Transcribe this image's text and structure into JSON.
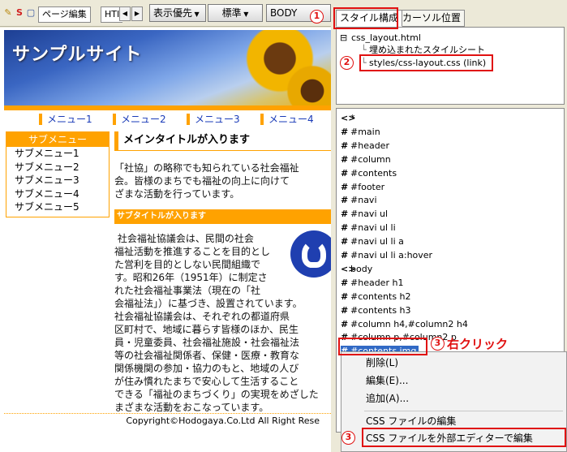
{
  "toolbar": {
    "tab_page_edit": "ページ編集",
    "tab_html": "HTI",
    "display_priority": "表示優先",
    "standard": "標準",
    "body": "BODY"
  },
  "preview": {
    "site_title": "サンプルサイト",
    "menu": [
      "メニュー1",
      "メニュー2",
      "メニュー3",
      "メニュー4"
    ],
    "submenu_title": "サブメニュー",
    "submenu": [
      "サブメニュー1",
      "サブメニュー2",
      "サブメニュー3",
      "サブメニュー4",
      "サブメニュー5"
    ],
    "main_title": "メインタイトルが入ります",
    "intro": "「社協」の略称でも知られている社会福祉\n会。皆様のまちでも福祉の向上に向けて\nざまな活動を行っています。",
    "subtitle": "サブタイトルが入ります",
    "body_text": " 社会福祉協議会は、民間の社会\n福祉活動を推進することを目的とし\nた営利を目的としない民間組織で\nす。昭和26年（1951年）に制定さ\nれた社会福祉事業法（現在の「社\n会福祉法」）に基づき、設置されています。\n社会福祉協議会は、それぞれの都道府県\n区町村で、地域に暮らす皆様のほか、民生\n員・児童委員、社会福祉施設・社会福祉法\n等の社会福祉関係者、保健・医療・教育な\n関係機関の参加・協力のもと、地域の人び\nが住み慣れたまちで安心して生活すること\nできる「福祉のまちづくり」の実現をめざした\nまざまな活動をおこなっています。",
    "footer": "Copyright©Hodogaya.Co.Ltd All Right Rese"
  },
  "panel": {
    "tab_style": "スタイル構成",
    "tab_cursor": "カーソル位置",
    "tree": [
      "css_layout.html",
      "埋め込まれたスタイルシート",
      "styles/css-layout.css (link)"
    ],
    "selectors": [
      {
        "glyph": "<>",
        "label": "*"
      },
      {
        "glyph": "#",
        "label": "#main"
      },
      {
        "glyph": "#",
        "label": "#header"
      },
      {
        "glyph": "#",
        "label": "#column"
      },
      {
        "glyph": "#",
        "label": "#contents"
      },
      {
        "glyph": "#",
        "label": "#footer"
      },
      {
        "glyph": "#",
        "label": "#navi"
      },
      {
        "glyph": "#",
        "label": "#navi ul"
      },
      {
        "glyph": "#",
        "label": "#navi ul li"
      },
      {
        "glyph": "#",
        "label": "#navi ul li a"
      },
      {
        "glyph": "#",
        "label": "#navi ul li a:hover"
      },
      {
        "glyph": "<>",
        "label": "body"
      },
      {
        "glyph": "#",
        "label": "#header h1"
      },
      {
        "glyph": "#",
        "label": "#contents h2"
      },
      {
        "glyph": "#",
        "label": "#contents h3"
      },
      {
        "glyph": "#",
        "label": "#column h4,#column2 h4"
      },
      {
        "glyph": "#",
        "label": "#column p,#column2 p"
      },
      {
        "glyph": "#",
        "label": "#contents img"
      }
    ]
  },
  "context_menu": {
    "delete": "削除(L)",
    "edit": "編集(E)...",
    "add": "追加(A)...",
    "edit_css": "CSS ファイルの編集",
    "edit_css_external": "CSS ファイルを外部エディターで編集"
  },
  "annotations": {
    "step1": "1",
    "step2": "2",
    "step3": "3",
    "step3b": "3",
    "right_click": "右クリック"
  }
}
